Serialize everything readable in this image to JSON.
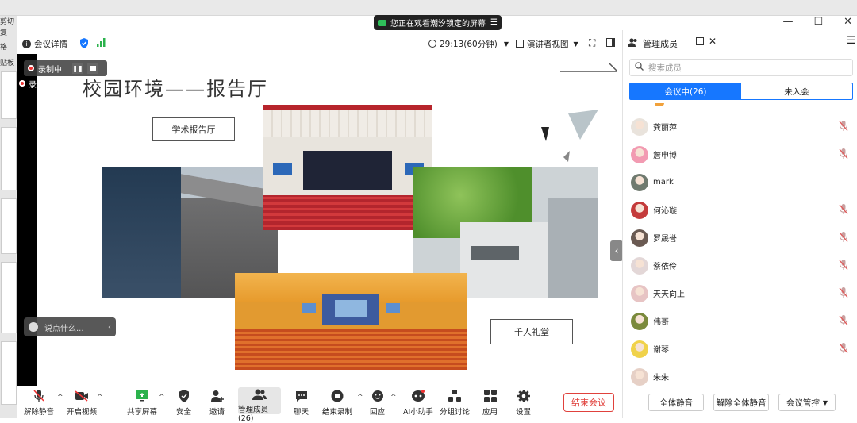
{
  "share_banner": {
    "text": "您正在观看潮汐锁定的屏幕"
  },
  "background_doc": {
    "labels": [
      "剪切",
      "复",
      "格",
      "贴板"
    ]
  },
  "topbar": {
    "meeting_info": "会议详情",
    "timer": "29:13(60分钟)",
    "view_mode": "演讲者视图"
  },
  "recording": {
    "badge": "录制中",
    "badge_repeat": "录制中"
  },
  "slide": {
    "title": "校园环境——报告厅",
    "label_academic": "学术报告厅",
    "label_auditorium": "千人礼堂"
  },
  "chat_input": {
    "placeholder": "说点什么..."
  },
  "toolbar": {
    "unmute": "解除静音",
    "video": "开启视频",
    "share": "共享屏幕",
    "security": "安全",
    "invite": "邀请",
    "members": "管理成员(26)",
    "chat": "聊天",
    "end_record": "结束录制",
    "reactions": "回应",
    "ai": "AI小助手",
    "breakout": "分组讨论",
    "apps": "应用",
    "settings": "设置",
    "end_meeting": "结束会议"
  },
  "panel": {
    "title": "管理成员",
    "search_placeholder": "搜索成员",
    "tab_in_meeting": "会议中(26)",
    "tab_not_joined": "未入会",
    "members": [
      {
        "name": "龚丽萍",
        "muted": true,
        "color": "#e9e3dc"
      },
      {
        "name": "詹申博",
        "muted": true,
        "color": "#f29bb2"
      },
      {
        "name": "mark",
        "muted": false,
        "color": "#6f7a6f"
      },
      {
        "name": "何沁璇",
        "muted": true,
        "color": "#c43b3b"
      },
      {
        "name": "罗晟誉",
        "muted": true,
        "color": "#6a5a52"
      },
      {
        "name": "蔡依伶",
        "muted": true,
        "color": "#e3d7d7"
      },
      {
        "name": "天天向上",
        "muted": true,
        "color": "#e7c4c4"
      },
      {
        "name": "伟哥",
        "muted": true,
        "color": "#7b8a3c"
      },
      {
        "name": "谢琴",
        "muted": true,
        "color": "#f0d24a"
      },
      {
        "name": "朱朱",
        "muted": false,
        "color": "#e6d0c6"
      }
    ],
    "mute_all": "全体静音",
    "unmute_all": "解除全体静音",
    "control": "会议管控"
  }
}
